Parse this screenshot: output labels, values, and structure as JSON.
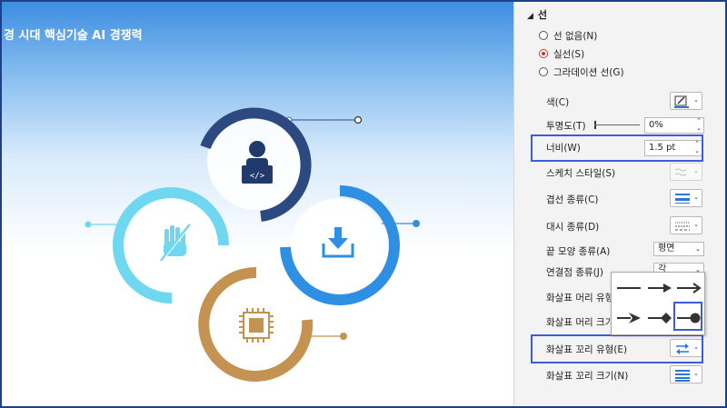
{
  "slide": {
    "title": "경 시대 핵심기술 AI 경쟁력"
  },
  "pane": {
    "section_title": "선",
    "radio_options": [
      {
        "label": "선 없음(N)",
        "selected": false
      },
      {
        "label": "실선(S)",
        "selected": true
      },
      {
        "label": "그라데이션 선(G)",
        "selected": false
      }
    ],
    "color_label": "색(C)",
    "transparency_label": "투명도(T)",
    "transparency_value": "0%",
    "width_label": "너비(W)",
    "width_value": "1.5 pt",
    "sketch_label": "스케치 스타일(S)",
    "compound_label": "겹선 종류(C)",
    "dash_label": "대시 종류(D)",
    "cap_label": "끝 모양 종류(A)",
    "cap_value": "평면",
    "join_label": "연결점 종류(J)",
    "join_value": "각",
    "begin_arrow_type_label": "화살표 머리 유형",
    "begin_arrow_size_label": "화살표 머리 크기",
    "end_arrow_type_label": "화살표 꼬리 유형(E)",
    "end_arrow_size_label": "화살표 꼬리 크기(N)"
  },
  "colors": {
    "accent_highlight": "#3d5bdb",
    "navy": "#2d4a80",
    "cyan": "#6fd8f0",
    "blue": "#2e8fe3",
    "bronze": "#c49352"
  },
  "icons": [
    "developer-icon",
    "no-touch-hand-icon",
    "download-icon",
    "chip-icon"
  ]
}
